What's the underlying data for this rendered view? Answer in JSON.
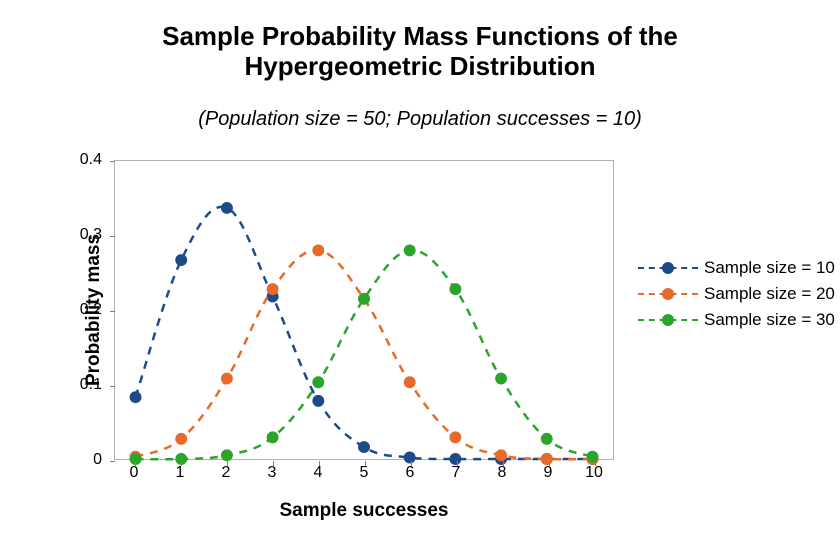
{
  "title_line1": "Sample Probability Mass Functions of the",
  "title_line2": "Hypergeometric Distribution",
  "subtitle": "(Population size = 50; Population successes = 10)",
  "xlabel": "Sample successes",
  "ylabel": "Probability mass",
  "legend": {
    "items": [
      {
        "label": "Sample size = 10",
        "color": "#1e4a8a"
      },
      {
        "label": "Sample size = 20",
        "color": "#e86a2a"
      },
      {
        "label": "Sample size = 30",
        "color": "#2aa52a"
      }
    ]
  },
  "chart_data": {
    "type": "line",
    "title": "Sample Probability Mass Functions of the Hypergeometric Distribution",
    "subtitle": "(Population size = 50; Population successes = 10)",
    "xlabel": "Sample successes",
    "ylabel": "Probability mass",
    "xlim": [
      0,
      10
    ],
    "ylim": [
      0,
      0.4
    ],
    "yticks": [
      0,
      0.1,
      0.2,
      0.3,
      0.4
    ],
    "xticks": [
      0,
      1,
      2,
      3,
      4,
      5,
      6,
      7,
      8,
      9,
      10
    ],
    "categories": [
      0,
      1,
      2,
      3,
      4,
      5,
      6,
      7,
      8,
      9,
      10
    ],
    "series": [
      {
        "name": "Sample size = 10",
        "color": "#1e4a8a",
        "values": [
          0.083,
          0.267,
          0.337,
          0.218,
          0.078,
          0.016,
          0.002,
          0.0,
          0.0,
          0.0,
          0.0
        ]
      },
      {
        "name": "Sample size = 20",
        "color": "#e86a2a",
        "values": [
          0.003,
          0.027,
          0.108,
          0.228,
          0.28,
          0.215,
          0.103,
          0.029,
          0.005,
          0.0,
          0.0
        ]
      },
      {
        "name": "Sample size = 30",
        "color": "#2aa52a",
        "values": [
          0.0,
          0.0,
          0.005,
          0.029,
          0.103,
          0.215,
          0.28,
          0.228,
          0.108,
          0.027,
          0.003
        ]
      }
    ]
  }
}
